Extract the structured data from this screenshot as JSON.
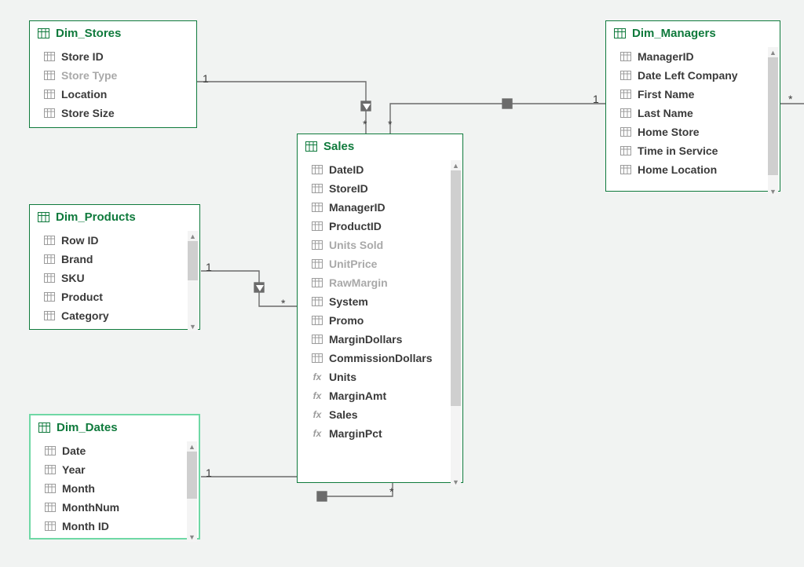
{
  "tables": {
    "dim_stores": {
      "title": "Dim_Stores",
      "fields": [
        {
          "label": "Store ID",
          "icon": "col"
        },
        {
          "label": "Store Type",
          "icon": "col",
          "dim": true
        },
        {
          "label": "Location",
          "icon": "col"
        },
        {
          "label": "Store Size",
          "icon": "col"
        }
      ]
    },
    "dim_products": {
      "title": "Dim_Products",
      "fields": [
        {
          "label": "Row ID",
          "icon": "col"
        },
        {
          "label": "Brand",
          "icon": "col"
        },
        {
          "label": "SKU",
          "icon": "col"
        },
        {
          "label": "Product",
          "icon": "col"
        },
        {
          "label": "Category",
          "icon": "col"
        }
      ]
    },
    "dim_dates": {
      "title": "Dim_Dates",
      "fields": [
        {
          "label": "Date",
          "icon": "col"
        },
        {
          "label": "Year",
          "icon": "col"
        },
        {
          "label": "Month",
          "icon": "col"
        },
        {
          "label": "MonthNum",
          "icon": "col"
        },
        {
          "label": "Month ID",
          "icon": "col"
        }
      ]
    },
    "dim_managers": {
      "title": "Dim_Managers",
      "fields": [
        {
          "label": "ManagerID",
          "icon": "col"
        },
        {
          "label": "Date Left Company",
          "icon": "col"
        },
        {
          "label": "First Name",
          "icon": "col"
        },
        {
          "label": "Last Name",
          "icon": "col"
        },
        {
          "label": "Home Store",
          "icon": "col"
        },
        {
          "label": "Time in Service",
          "icon": "col"
        },
        {
          "label": "Home Location",
          "icon": "col"
        }
      ]
    },
    "sales": {
      "title": "Sales",
      "fields": [
        {
          "label": "DateID",
          "icon": "col"
        },
        {
          "label": "StoreID",
          "icon": "col"
        },
        {
          "label": "ManagerID",
          "icon": "col"
        },
        {
          "label": "ProductID",
          "icon": "col"
        },
        {
          "label": "Units Sold",
          "icon": "col",
          "dim": true
        },
        {
          "label": "UnitPrice",
          "icon": "col",
          "dim": true
        },
        {
          "label": "RawMargin",
          "icon": "col",
          "dim": true
        },
        {
          "label": "System",
          "icon": "col"
        },
        {
          "label": "Promo",
          "icon": "col"
        },
        {
          "label": "MarginDollars",
          "icon": "col"
        },
        {
          "label": "CommissionDollars",
          "icon": "col"
        },
        {
          "label": "Units",
          "icon": "fx"
        },
        {
          "label": "MarginAmt",
          "icon": "fx"
        },
        {
          "label": "Sales",
          "icon": "fx"
        },
        {
          "label": "MarginPct",
          "icon": "fx"
        }
      ]
    }
  },
  "cardinality": {
    "one": "1",
    "many": "*"
  }
}
